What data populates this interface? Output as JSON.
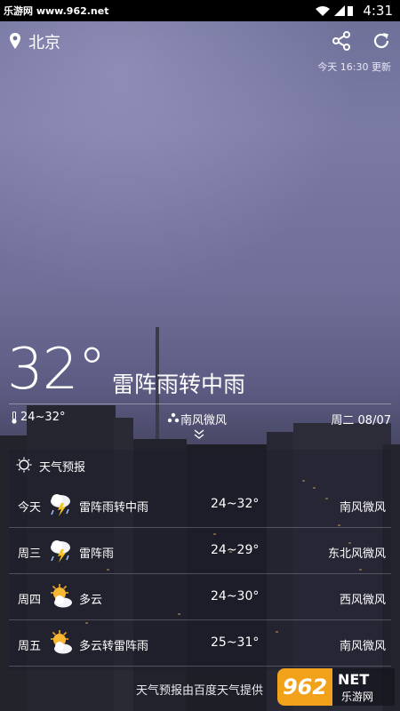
{
  "status_bar": {
    "site_tag": "乐游网 www.962.net",
    "time": "4:31"
  },
  "header": {
    "city": "北京",
    "updated": "今天 16:30 更新"
  },
  "current": {
    "temp": "32°",
    "desc": "雷阵雨转中雨",
    "range": "24~32°",
    "wind": "南风微风",
    "date": "周二 08/07"
  },
  "forecast": {
    "title": "天气预报",
    "rows": [
      {
        "day": "今天",
        "icon": "thunderstorm-icon",
        "cond": "雷阵雨转中雨",
        "temp": "24~32°",
        "wind": "南风微风"
      },
      {
        "day": "周三",
        "icon": "thunderstorm-icon",
        "cond": "雷阵雨",
        "temp": "24~29°",
        "wind": "东北风微风"
      },
      {
        "day": "周四",
        "icon": "partly-cloudy-icon",
        "cond": "多云",
        "temp": "24~30°",
        "wind": "西风微风"
      },
      {
        "day": "周五",
        "icon": "partly-cloudy-icon",
        "cond": "多云转雷阵雨",
        "temp": "25~31°",
        "wind": "南风微风"
      }
    ]
  },
  "footer": "天气预报由百度天气提供",
  "watermark": {
    "badge": "962",
    "brand": "NET",
    "name": "乐游网"
  }
}
